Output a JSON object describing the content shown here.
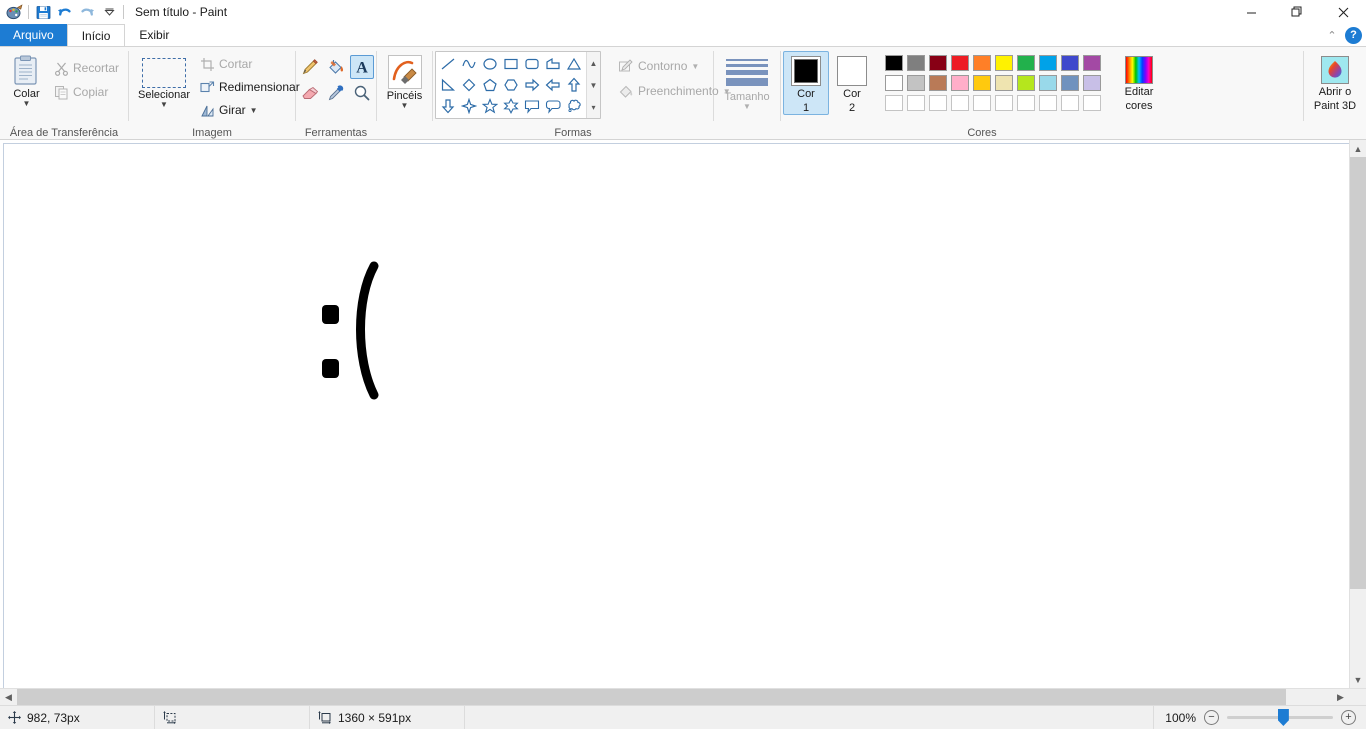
{
  "window": {
    "title": "Sem título - Paint",
    "quick_access": [
      {
        "name": "paint-icon",
        "tip": "Paint"
      },
      {
        "name": "save-icon",
        "tip": "Salvar"
      },
      {
        "name": "undo-icon",
        "tip": "Desfazer"
      },
      {
        "name": "redo-icon",
        "tip": "Refazer"
      },
      {
        "name": "customize-qat-icon",
        "tip": "Personalizar Barra de Ferramentas de Acesso Rápido"
      }
    ],
    "controls": {
      "minimize": "—",
      "restore": "❐",
      "close": "✕",
      "collapse_ribbon": "⌃",
      "help": "?"
    }
  },
  "tabs": [
    {
      "label": "Arquivo",
      "name": "tab-file",
      "state": "file"
    },
    {
      "label": "Início",
      "name": "tab-home",
      "state": "active"
    },
    {
      "label": "Exibir",
      "name": "tab-view",
      "state": "normal"
    }
  ],
  "ribbon": {
    "clipboard": {
      "label": "Área de Transferência",
      "paste": "Colar",
      "cut": "Recortar",
      "copy": "Copiar"
    },
    "image": {
      "label": "Imagem",
      "select": "Selecionar",
      "crop": "Cortar",
      "resize": "Redimensionar",
      "rotate": "Girar"
    },
    "tools": {
      "label": "Ferramentas",
      "items": [
        {
          "name": "pencil-tool",
          "title": "Lápis",
          "selected": false
        },
        {
          "name": "fill-tool",
          "title": "Preencher com cor",
          "selected": false
        },
        {
          "name": "text-tool",
          "title": "Texto",
          "selected": true
        },
        {
          "name": "eraser-tool",
          "title": "Borracha",
          "selected": false
        },
        {
          "name": "color-picker-tool",
          "title": "Seletor de Cores",
          "selected": false
        },
        {
          "name": "magnifier-tool",
          "title": "Lupa",
          "selected": false
        }
      ],
      "brushes": "Pincéis"
    },
    "shapes": {
      "label": "Formas",
      "items": [
        "line",
        "curve",
        "oval",
        "rectangle",
        "rounded-rectangle",
        "polygon",
        "triangle",
        "right-triangle",
        "diamond",
        "pentagon",
        "hexagon",
        "right-arrow",
        "left-arrow",
        "up-arrow",
        "down-arrow",
        "four-point-star",
        "five-point-star",
        "six-point-star",
        "rectangular-callout",
        "rounded-callout",
        "cloud-callout"
      ],
      "outline": "Contorno",
      "fill": "Preenchimento",
      "size": "Tamanho"
    },
    "colors": {
      "label": "Cores",
      "color1": "Cor\n1",
      "color1_line1": "Cor",
      "color1_line2": "1",
      "color2_line1": "Cor",
      "color2_line2": "2",
      "color1_value": "#000000",
      "color2_value": "#ffffff",
      "palette_row1": [
        "#000000",
        "#7f7f7f",
        "#880015",
        "#ed1c24",
        "#ff7f27",
        "#fff200",
        "#22b14c",
        "#00a2e8",
        "#3f48cc",
        "#a349a4"
      ],
      "palette_row2": [
        "#ffffff",
        "#c3c3c3",
        "#b97a57",
        "#ffaec9",
        "#ffc90e",
        "#efe4b0",
        "#b5e61d",
        "#99d9ea",
        "#7092be",
        "#c8bfe7"
      ],
      "palette_row3": [
        "",
        "",
        "",
        "",
        "",
        "",
        "",
        "",
        "",
        ""
      ],
      "edit_colors_line1": "Editar",
      "edit_colors_line2": "cores",
      "paint3d_line1": "Abrir o",
      "paint3d_line2": "Paint 3D"
    }
  },
  "canvas": {
    "drawing_description": "sad-face-emoticon",
    "drawing_text": ":("
  },
  "statusbar": {
    "cursor_position": "982, 73px",
    "selection_size": "",
    "image_size": "1360 × 591px",
    "zoom_level": "100%",
    "zoom_out": "−",
    "zoom_in": "+"
  }
}
